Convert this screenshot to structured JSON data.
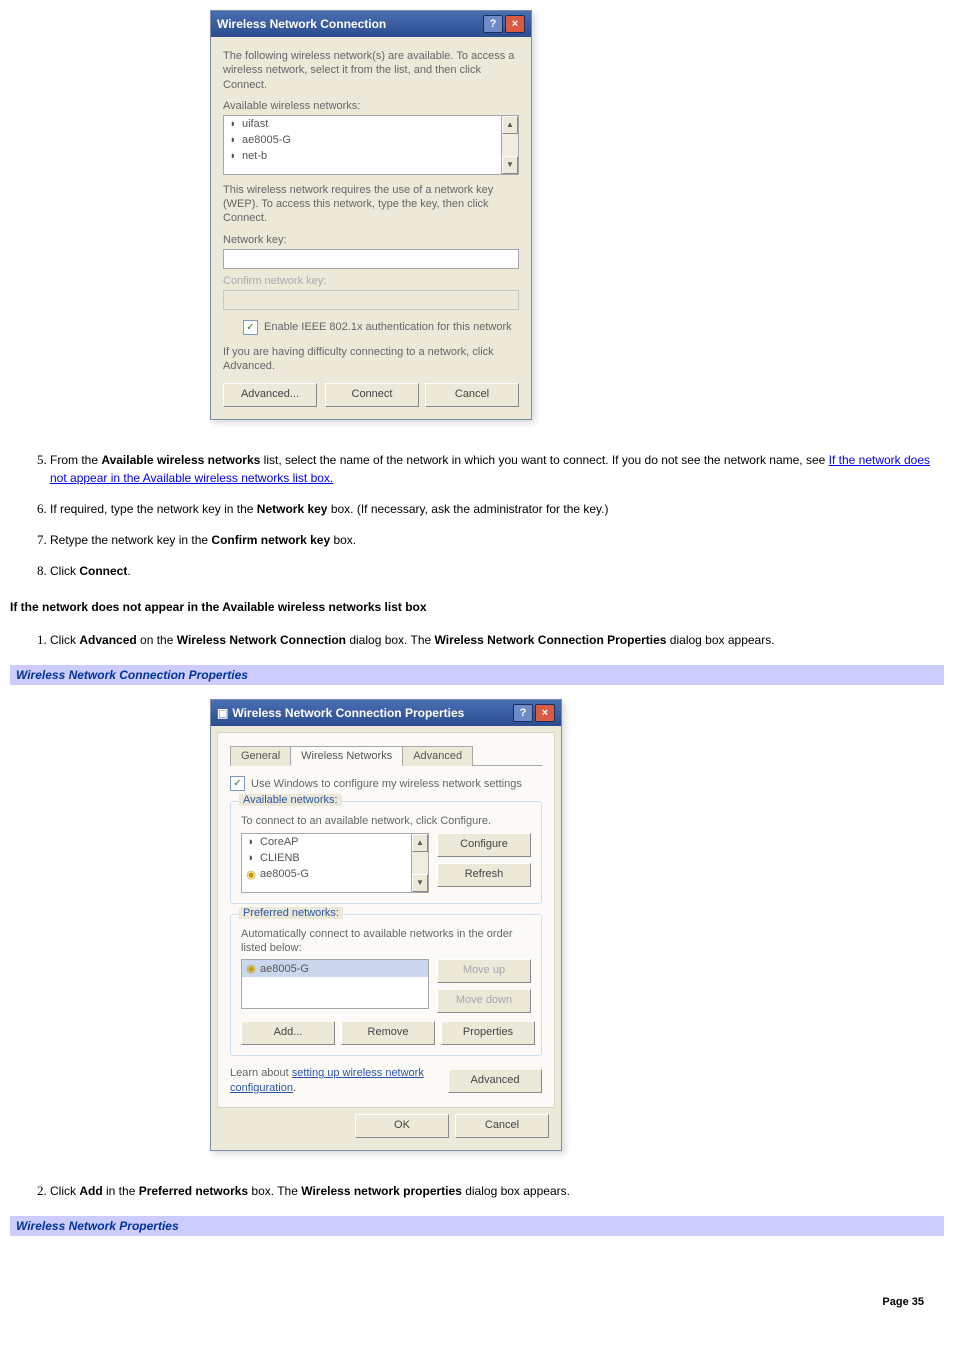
{
  "dialog1": {
    "title": "Wireless Network Connection",
    "intro": "The following wireless network(s) are available. To access a wireless network, select it from the list, and then click Connect.",
    "available_label": "Available wireless networks:",
    "networks": [
      "uifast",
      "ae8005-G",
      "net-b"
    ],
    "wep_text": "This wireless network requires the use of a network key (WEP). To access this network, type the key, then click Connect.",
    "network_key_label": "Network key:",
    "confirm_key_label": "Confirm network key:",
    "enable_8021x": "Enable IEEE 802.1x authentication for this network",
    "difficulty": "If you are having difficulty connecting to a network, click Advanced.",
    "advanced_btn": "Advanced...",
    "connect_btn": "Connect",
    "cancel_btn": "Cancel"
  },
  "steps1": {
    "s5a": "From the ",
    "s5b": "Available wireless networks",
    "s5c": " list, select the name of the network in which you want to connect. If you do not see the network name, see ",
    "s5link": "If the network does not appear in the Available wireless networks list box.",
    "s6a": "If required, type the network key in the ",
    "s6b": "Network key",
    "s6c": " box. (If necessary, ask the administrator for the key.)",
    "s7a": "Retype the network key in the ",
    "s7b": "Confirm network key",
    "s7c": " box.",
    "s8a": "Click ",
    "s8b": "Connect",
    "s8c": "."
  },
  "subheading1": "If the network does not appear in the Available wireless networks list box",
  "steps2": {
    "s1a": "Click ",
    "s1b": "Advanced",
    "s1c": " on the ",
    "s1d": "Wireless Network Connection",
    "s1e": " dialog box. The ",
    "s1f": "Wireless Network Connection Properties",
    "s1g": " dialog box appears."
  },
  "heading1": "Wireless Network Connection Properties",
  "dialog2": {
    "title": "Wireless Network Connection Properties",
    "tabs": [
      "General",
      "Wireless Networks",
      "Advanced"
    ],
    "use_windows": "Use Windows to configure my wireless network settings",
    "available_group": "Available networks:",
    "available_desc": "To connect to an available network, click Configure.",
    "available_nets": [
      "CoreAP",
      "CLIENB",
      "ae8005-G"
    ],
    "configure_btn": "Configure",
    "refresh_btn": "Refresh",
    "preferred_group": "Preferred networks:",
    "preferred_desc": "Automatically connect to available networks in the order listed below:",
    "preferred_nets": [
      "ae8005-G"
    ],
    "moveup_btn": "Move up",
    "movedown_btn": "Move down",
    "add_btn": "Add...",
    "remove_btn": "Remove",
    "properties_btn": "Properties",
    "learn_a": "Learn about ",
    "learn_link": "setting up wireless network configuration",
    "learn_b": ".",
    "advanced_btn": "Advanced",
    "ok_btn": "OK",
    "cancel_btn": "Cancel"
  },
  "steps3": {
    "s2a": "Click ",
    "s2b": "Add",
    "s2c": " in the ",
    "s2d": "Preferred networks",
    "s2e": " box. The ",
    "s2f": "Wireless network properties",
    "s2g": " dialog box appears."
  },
  "heading2": "Wireless Network Properties",
  "page_num": "Page 35"
}
